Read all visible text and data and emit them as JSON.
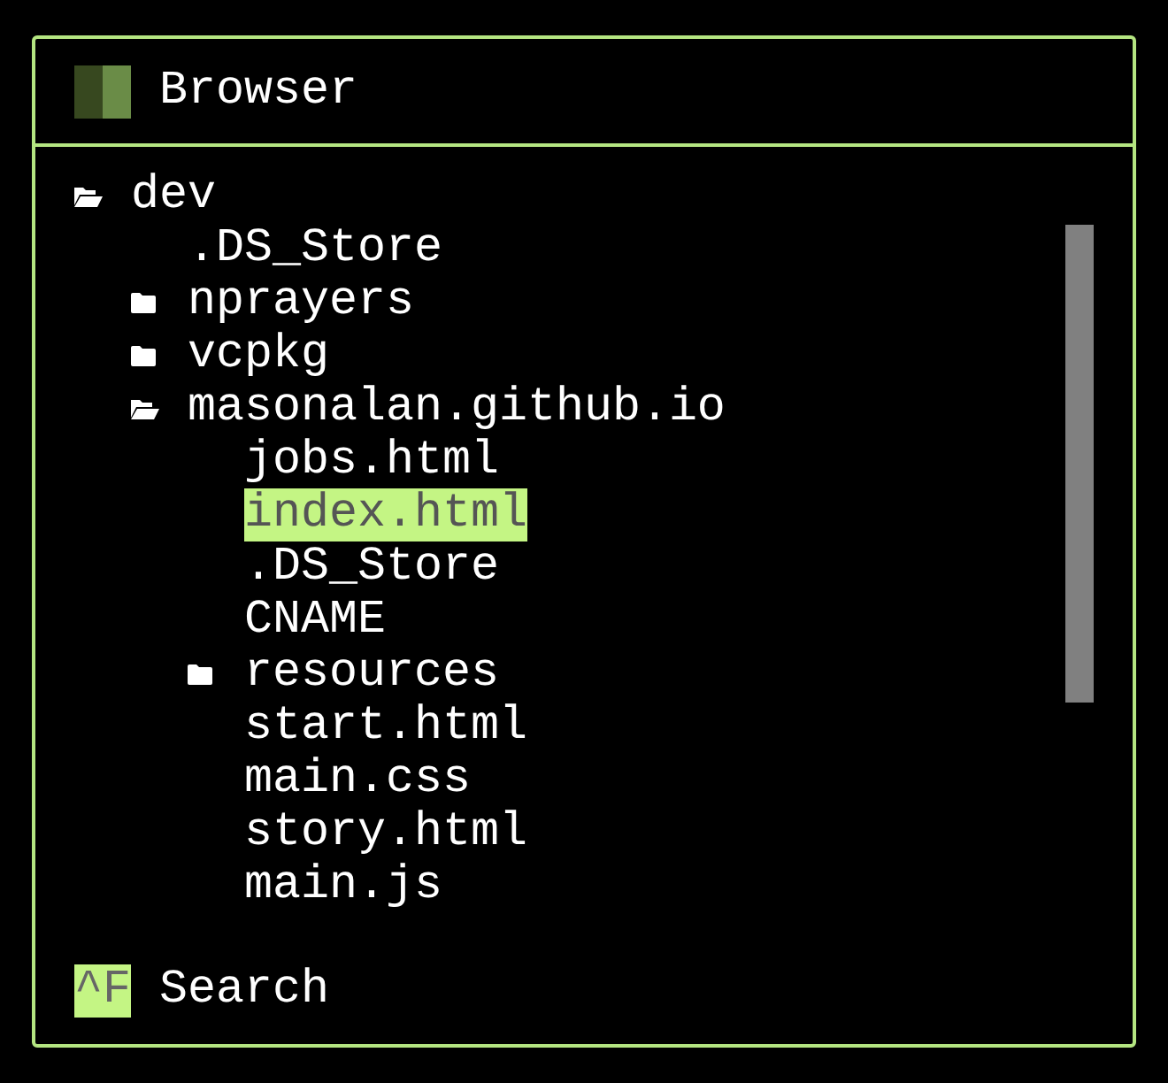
{
  "window": {
    "title": "Browser"
  },
  "tree": [
    {
      "name": "dev",
      "kind": "folder",
      "expanded": true,
      "selected": false,
      "children": [
        {
          "name": ".DS_Store",
          "kind": "file",
          "selected": false
        },
        {
          "name": "nprayers",
          "kind": "folder",
          "expanded": false,
          "selected": false
        },
        {
          "name": "vcpkg",
          "kind": "folder",
          "expanded": false,
          "selected": false
        },
        {
          "name": "masonalan.github.io",
          "kind": "folder",
          "expanded": true,
          "selected": false,
          "children": [
            {
              "name": "jobs.html",
              "kind": "file",
              "selected": false
            },
            {
              "name": "index.html",
              "kind": "file",
              "selected": true
            },
            {
              "name": ".DS_Store",
              "kind": "file",
              "selected": false
            },
            {
              "name": "CNAME",
              "kind": "file",
              "selected": false
            },
            {
              "name": "resources",
              "kind": "folder",
              "expanded": false,
              "selected": false
            },
            {
              "name": "start.html",
              "kind": "file",
              "selected": false
            },
            {
              "name": "main.css",
              "kind": "file",
              "selected": false
            },
            {
              "name": "story.html",
              "kind": "file",
              "selected": false
            },
            {
              "name": "main.js",
              "kind": "file",
              "selected": false
            }
          ]
        }
      ]
    }
  ],
  "footer": {
    "shortcut": "^F",
    "label": "Search"
  }
}
